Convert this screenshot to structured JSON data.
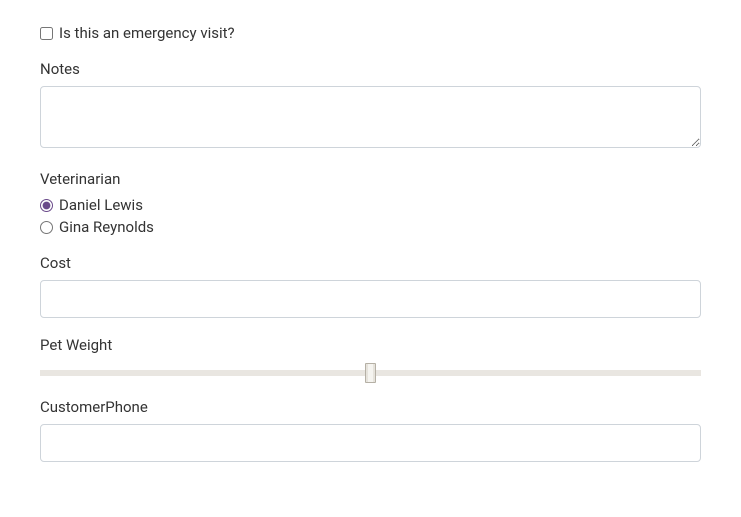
{
  "emergency": {
    "label": "Is this an emergency visit?",
    "checked": false
  },
  "notes": {
    "label": "Notes",
    "value": ""
  },
  "veterinarian": {
    "label": "Veterinarian",
    "options": [
      {
        "label": "Daniel Lewis",
        "selected": true
      },
      {
        "label": "Gina Reynolds",
        "selected": false
      }
    ]
  },
  "cost": {
    "label": "Cost",
    "value": ""
  },
  "petWeight": {
    "label": "Pet Weight",
    "value": 50,
    "min": 0,
    "max": 100
  },
  "customerPhone": {
    "label": "CustomerPhone",
    "value": ""
  }
}
